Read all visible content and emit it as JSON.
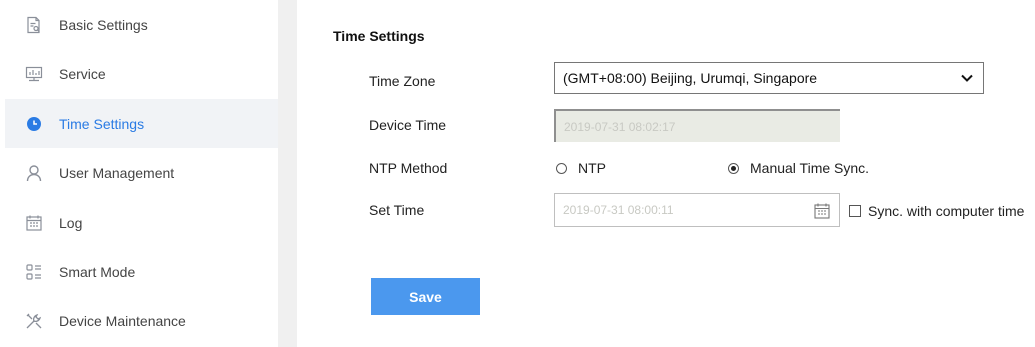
{
  "sidebar": {
    "items": [
      {
        "label": "Basic Settings",
        "icon": "document-search-icon",
        "active": false
      },
      {
        "label": "Service",
        "icon": "monitor-network-icon",
        "active": false
      },
      {
        "label": "Time Settings",
        "icon": "clock-icon",
        "active": true
      },
      {
        "label": "User Management",
        "icon": "user-icon",
        "active": false
      },
      {
        "label": "Log",
        "icon": "calendar-log-icon",
        "active": false
      },
      {
        "label": "Smart Mode",
        "icon": "grid-list-icon",
        "active": false
      },
      {
        "label": "Device Maintenance",
        "icon": "tools-icon",
        "active": false
      }
    ]
  },
  "main": {
    "title": "Time Settings",
    "time_zone": {
      "label": "Time Zone",
      "value": "(GMT+08:00) Beijing, Urumqi, Singapore"
    },
    "device_time": {
      "label": "Device Time",
      "value": "2019-07-31 08:02:17"
    },
    "ntp_method": {
      "label": "NTP Method",
      "options": [
        {
          "label": "NTP",
          "checked": false
        },
        {
          "label": "Manual Time Sync.",
          "checked": true
        }
      ]
    },
    "set_time": {
      "label": "Set Time",
      "value": "2019-07-31 08:00:11"
    },
    "sync_computer": {
      "label": "Sync. with computer time",
      "checked": false
    },
    "save_label": "Save"
  },
  "colors": {
    "accent": "#2a7be4",
    "button": "#4b98ee",
    "active_bg": "#f1f3f6"
  }
}
